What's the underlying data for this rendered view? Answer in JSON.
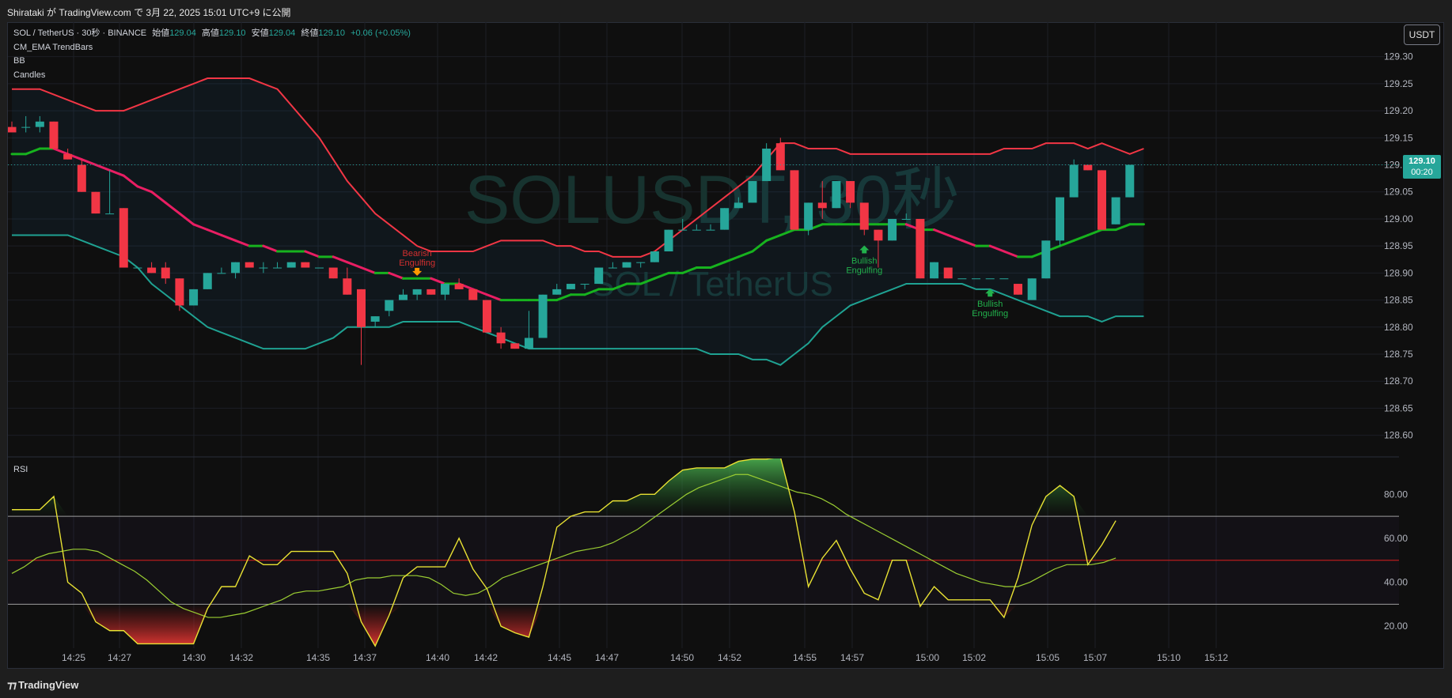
{
  "header": {
    "publish_line": "Shirataki が TradingView.com で 3月 22, 2025 15:01 UTC+9 に公開"
  },
  "legend": {
    "symbol": "SOL / TetherUS · 30秒 · BINANCE",
    "open_label": "始値",
    "open": "129.04",
    "high_label": "高値",
    "high": "129.10",
    "low_label": "安値",
    "low": "129.04",
    "close_label": "終値",
    "close": "129.10",
    "change": "+0.06 (+0.05%)",
    "indicators": [
      "CM_EMA TrendBars",
      "BB",
      "Candles"
    ]
  },
  "currency_button": "USDT",
  "last_price": {
    "value": "129.10",
    "countdown": "00:20"
  },
  "watermark": {
    "line1": "SOLUSDT, 30秒",
    "line2": "SOL / TetherUS"
  },
  "rsi_label": "RSI",
  "footer_logo": "TradingView",
  "colors": {
    "up": "#26a69a",
    "down": "#f23645",
    "bb_upper": "#f23645",
    "bb_lower": "#1fa292",
    "ema_up": "#17b31e",
    "ema_down": "#e91e63",
    "rsi": "#e8e133",
    "rsi_ma": "#9acd32",
    "rsi_mid": "#b71c1c",
    "background": "#0f0f0f"
  },
  "chart_data": [
    {
      "type": "candlestick",
      "title": "SOL / TetherUS · 30秒 · BINANCE",
      "y_ticks": [
        "128.60",
        "128.65",
        "128.70",
        "128.75",
        "128.80",
        "128.85",
        "128.90",
        "128.95",
        "129.00",
        "129.05",
        "129.10",
        "129.15",
        "129.20",
        "129.25",
        "129.30"
      ],
      "ylim": [
        128.56,
        129.32
      ],
      "x_ticks": [
        "14:25",
        "14:27",
        "14:30",
        "14:32",
        "14:35",
        "14:37",
        "14:40",
        "14:42",
        "14:45",
        "14:47",
        "14:50",
        "14:52",
        "14:55",
        "14:57",
        "15:00",
        "15:02",
        "15:05",
        "15:07",
        "15:10",
        "15:12"
      ],
      "candles": [
        [
          129.17,
          129.18,
          129.16,
          129.16
        ],
        [
          129.17,
          129.19,
          129.16,
          129.17
        ],
        [
          129.17,
          129.19,
          129.16,
          129.18
        ],
        [
          129.18,
          129.18,
          129.13,
          129.13
        ],
        [
          129.12,
          129.13,
          129.11,
          129.11
        ],
        [
          129.1,
          129.11,
          129.05,
          129.05
        ],
        [
          129.05,
          129.05,
          129.01,
          129.01
        ],
        [
          129.01,
          129.09,
          129.01,
          129.01
        ],
        [
          129.02,
          129.02,
          128.91,
          128.91
        ],
        [
          128.91,
          128.91,
          128.91,
          128.91
        ],
        [
          128.91,
          128.92,
          128.9,
          128.9
        ],
        [
          128.91,
          128.92,
          128.88,
          128.89
        ],
        [
          128.89,
          128.89,
          128.83,
          128.84
        ],
        [
          128.84,
          128.87,
          128.84,
          128.87
        ],
        [
          128.87,
          128.9,
          128.87,
          128.9
        ],
        [
          128.9,
          128.91,
          128.9,
          128.9
        ],
        [
          128.9,
          128.92,
          128.89,
          128.92
        ],
        [
          128.92,
          128.92,
          128.91,
          128.91
        ],
        [
          128.91,
          128.92,
          128.9,
          128.91
        ],
        [
          128.91,
          128.92,
          128.91,
          128.91
        ],
        [
          128.91,
          128.92,
          128.91,
          128.92
        ],
        [
          128.92,
          128.92,
          128.91,
          128.91
        ],
        [
          128.91,
          128.91,
          128.91,
          128.91
        ],
        [
          128.91,
          128.91,
          128.89,
          128.89
        ],
        [
          128.89,
          128.91,
          128.86,
          128.86
        ],
        [
          128.87,
          128.87,
          128.73,
          128.8
        ],
        [
          128.81,
          128.82,
          128.8,
          128.82
        ],
        [
          128.83,
          128.85,
          128.82,
          128.85
        ],
        [
          128.85,
          128.87,
          128.85,
          128.86
        ],
        [
          128.86,
          128.87,
          128.85,
          128.87
        ],
        [
          128.87,
          128.87,
          128.86,
          128.86
        ],
        [
          128.86,
          128.87,
          128.85,
          128.88
        ],
        [
          128.88,
          128.89,
          128.87,
          128.87
        ],
        [
          128.87,
          128.87,
          128.86,
          128.85
        ],
        [
          128.85,
          128.85,
          128.79,
          128.79
        ],
        [
          128.79,
          128.8,
          128.76,
          128.77
        ],
        [
          128.77,
          128.77,
          128.76,
          128.76
        ],
        [
          128.76,
          128.83,
          128.76,
          128.78
        ],
        [
          128.78,
          128.86,
          128.78,
          128.86
        ],
        [
          128.86,
          128.88,
          128.86,
          128.87
        ],
        [
          128.87,
          128.88,
          128.87,
          128.88
        ],
        [
          128.88,
          128.88,
          128.87,
          128.88
        ],
        [
          128.88,
          128.91,
          128.88,
          128.91
        ],
        [
          128.91,
          128.92,
          128.91,
          128.91
        ],
        [
          128.91,
          128.92,
          128.91,
          128.92
        ],
        [
          128.92,
          128.92,
          128.91,
          128.92
        ],
        [
          128.92,
          128.94,
          128.92,
          128.94
        ],
        [
          128.94,
          128.98,
          128.94,
          128.98
        ],
        [
          128.98,
          129.0,
          128.98,
          128.98
        ],
        [
          128.98,
          128.99,
          128.98,
          128.98
        ],
        [
          128.98,
          128.99,
          128.98,
          128.98
        ],
        [
          128.98,
          129.02,
          128.98,
          129.02
        ],
        [
          129.02,
          129.04,
          129.02,
          129.03
        ],
        [
          129.03,
          129.07,
          129.03,
          129.07
        ],
        [
          129.07,
          129.14,
          129.07,
          129.13
        ],
        [
          129.14,
          129.15,
          129.09,
          129.09
        ],
        [
          129.09,
          129.09,
          128.98,
          128.98
        ],
        [
          128.98,
          129.03,
          128.97,
          129.03
        ],
        [
          129.03,
          129.07,
          129.0,
          129.02
        ],
        [
          129.02,
          129.07,
          129.02,
          129.07
        ],
        [
          129.07,
          129.07,
          129.02,
          129.03
        ],
        [
          129.03,
          129.0,
          128.97,
          128.98
        ],
        [
          128.98,
          128.98,
          128.91,
          128.96
        ],
        [
          128.96,
          129.0,
          128.96,
          129.0
        ],
        [
          129.0,
          129.01,
          129.0,
          129.0
        ],
        [
          129.0,
          129.0,
          128.89,
          128.89
        ],
        [
          128.89,
          128.92,
          128.89,
          128.92
        ],
        [
          128.91,
          128.91,
          128.89,
          128.89
        ],
        [
          128.89,
          128.89,
          128.89,
          128.89
        ],
        [
          128.89,
          128.89,
          128.89,
          128.89
        ],
        [
          128.89,
          128.89,
          128.89,
          128.89
        ],
        [
          128.89,
          128.89,
          128.89,
          128.89
        ],
        [
          128.88,
          128.88,
          128.86,
          128.86
        ],
        [
          128.85,
          128.89,
          128.85,
          128.89
        ],
        [
          128.89,
          128.96,
          128.89,
          128.96
        ],
        [
          128.96,
          129.04,
          128.95,
          129.04
        ],
        [
          129.04,
          129.11,
          129.04,
          129.1
        ],
        [
          129.1,
          129.1,
          129.09,
          129.09
        ],
        [
          129.09,
          129.09,
          128.98,
          128.98
        ],
        [
          128.99,
          129.04,
          128.99,
          129.04
        ],
        [
          129.04,
          129.1,
          129.04,
          129.1
        ]
      ],
      "bb_upper": [
        129.24,
        129.24,
        129.24,
        129.23,
        129.22,
        129.21,
        129.2,
        129.2,
        129.2,
        129.21,
        129.22,
        129.23,
        129.24,
        129.25,
        129.26,
        129.26,
        129.26,
        129.26,
        129.25,
        129.24,
        129.21,
        129.18,
        129.15,
        129.11,
        129.07,
        129.04,
        129.01,
        128.99,
        128.97,
        128.95,
        128.94,
        128.94,
        128.94,
        128.94,
        128.95,
        128.96,
        128.96,
        128.96,
        128.96,
        128.95,
        128.95,
        128.94,
        128.94,
        128.93,
        128.93,
        128.93,
        128.94,
        128.96,
        128.98,
        129.0,
        129.02,
        129.04,
        129.06,
        129.08,
        129.11,
        129.14,
        129.14,
        129.13,
        129.13,
        129.13,
        129.12,
        129.12,
        129.12,
        129.12,
        129.12,
        129.12,
        129.12,
        129.12,
        129.12,
        129.12,
        129.12,
        129.13,
        129.13,
        129.13,
        129.14,
        129.14,
        129.14,
        129.13,
        129.14,
        129.13,
        129.12,
        129.13
      ],
      "bb_lower": [
        128.97,
        128.97,
        128.97,
        128.97,
        128.97,
        128.96,
        128.95,
        128.94,
        128.93,
        128.91,
        128.88,
        128.86,
        128.84,
        128.82,
        128.8,
        128.79,
        128.78,
        128.77,
        128.76,
        128.76,
        128.76,
        128.76,
        128.77,
        128.78,
        128.8,
        128.8,
        128.8,
        128.8,
        128.81,
        128.81,
        128.81,
        128.81,
        128.81,
        128.8,
        128.79,
        128.78,
        128.77,
        128.76,
        128.76,
        128.76,
        128.76,
        128.76,
        128.76,
        128.76,
        128.76,
        128.76,
        128.76,
        128.76,
        128.76,
        128.76,
        128.75,
        128.75,
        128.75,
        128.74,
        128.74,
        128.73,
        128.75,
        128.77,
        128.8,
        128.82,
        128.84,
        128.85,
        128.86,
        128.87,
        128.88,
        128.88,
        128.88,
        128.88,
        128.88,
        128.87,
        128.87,
        128.86,
        128.85,
        128.84,
        128.83,
        128.82,
        128.82,
        128.82,
        128.81,
        128.82,
        128.82,
        128.82
      ],
      "ema": [
        129.12,
        129.12,
        129.13,
        129.13,
        129.12,
        129.11,
        129.1,
        129.09,
        129.08,
        129.06,
        129.05,
        129.03,
        129.01,
        128.99,
        128.98,
        128.97,
        128.96,
        128.95,
        128.95,
        128.94,
        128.94,
        128.94,
        128.93,
        128.93,
        128.92,
        128.91,
        128.9,
        128.9,
        128.89,
        128.89,
        128.89,
        128.88,
        128.88,
        128.87,
        128.86,
        128.85,
        128.85,
        128.85,
        128.85,
        128.85,
        128.86,
        128.86,
        128.87,
        128.87,
        128.88,
        128.88,
        128.89,
        128.9,
        128.9,
        128.91,
        128.91,
        128.92,
        128.93,
        128.94,
        128.96,
        128.97,
        128.98,
        128.98,
        128.99,
        128.99,
        128.99,
        128.99,
        128.99,
        128.99,
        128.99,
        128.98,
        128.98,
        128.97,
        128.96,
        128.95,
        128.95,
        128.94,
        128.93,
        128.93,
        128.94,
        128.95,
        128.96,
        128.97,
        128.98,
        128.98,
        128.99,
        128.99
      ]
    },
    {
      "type": "line",
      "title": "RSI",
      "y_ticks": [
        "20.00",
        "40.00",
        "60.00",
        "80.00"
      ],
      "ylim": [
        10,
        97
      ],
      "levels": [
        70,
        50,
        30
      ],
      "rsi": [
        73,
        73,
        73,
        79,
        40,
        35,
        22,
        18,
        18,
        12,
        12,
        12,
        12,
        12,
        28,
        38,
        38,
        52,
        48,
        48,
        54,
        54,
        54,
        54,
        44,
        22,
        11,
        25,
        42,
        47,
        47,
        47,
        60,
        46,
        37,
        20,
        17,
        15,
        38,
        65,
        70,
        72,
        72,
        77,
        77,
        80,
        80,
        86,
        91,
        92,
        92,
        92,
        95,
        96,
        96,
        97,
        72,
        38,
        51,
        59,
        46,
        35,
        32,
        50,
        50,
        29,
        38,
        32,
        32,
        32,
        32,
        24,
        42,
        66,
        79,
        84,
        79,
        48,
        57,
        68
      ],
      "rsi_ma": [
        44,
        47,
        51,
        53,
        54,
        55,
        55,
        54,
        51,
        48,
        45,
        41,
        36,
        31,
        28,
        26,
        24,
        24,
        25,
        26,
        28,
        30,
        32,
        35,
        36,
        36,
        37,
        38,
        41,
        42,
        42,
        43,
        43,
        43,
        42,
        39,
        35,
        34,
        35,
        38,
        42,
        44,
        46,
        48,
        50,
        52,
        54,
        55,
        56,
        58,
        61,
        64,
        68,
        72,
        76,
        80,
        83,
        85,
        87,
        89,
        89,
        87,
        85,
        83,
        81,
        80,
        78,
        75,
        71,
        68,
        65,
        62,
        59,
        56,
        53,
        50,
        47,
        44,
        42,
        40,
        39,
        38,
        38,
        40,
        43,
        46,
        48,
        48,
        48,
        49,
        51
      ]
    }
  ],
  "annotations": [
    {
      "text_top": "Bearish",
      "text_bottom": "Engulfing",
      "candle": 29
    },
    {
      "text_top": "Bullish",
      "text_bottom": "Engulfing",
      "candle": 61
    },
    {
      "text_top": "Bullish",
      "text_bottom": "Engulfing",
      "candle": 70
    }
  ]
}
